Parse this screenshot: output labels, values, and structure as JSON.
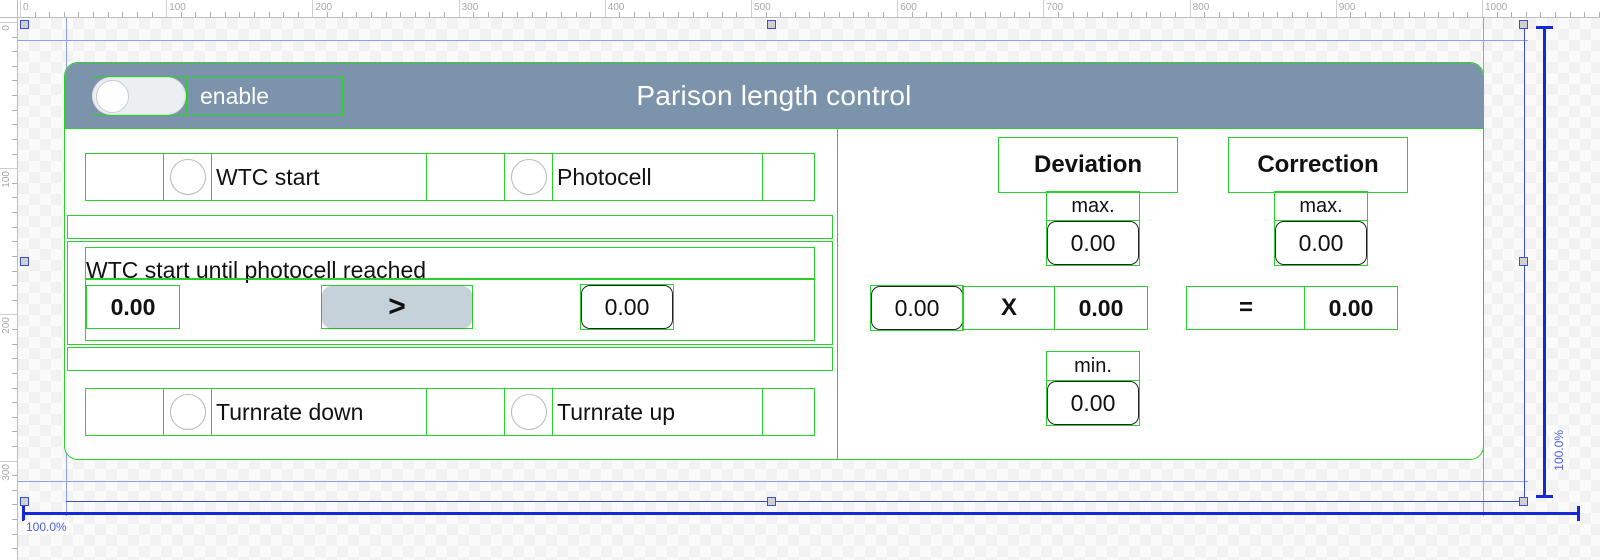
{
  "editor": {
    "ruler_h_labels": [
      "0",
      "100",
      "200",
      "300",
      "400",
      "500",
      "600",
      "700",
      "800",
      "900",
      "1000"
    ],
    "ruler_v_labels": [
      "0",
      "100",
      "200",
      "300"
    ],
    "zoom_bottom": "100.0%",
    "zoom_right": "100.0%"
  },
  "widget": {
    "header": {
      "title": "Parison length control",
      "toggle_name": "enable-toggle",
      "toggle_state": "off",
      "enable_label": "enable",
      "bg_color": "#7b93ab",
      "title_color": "#ffffff"
    },
    "left": {
      "top_row": [
        {
          "label": "WTC start",
          "led": "indicator-off"
        },
        {
          "label": "Photocell",
          "led": "indicator-off"
        }
      ],
      "middle": {
        "title": "WTC start until photocell reached",
        "actual_value": "0.00",
        "button_label": ">",
        "setpoint_value": "0.00"
      },
      "bottom_row": [
        {
          "label": "Turnrate down",
          "led": "indicator-off"
        },
        {
          "label": "Turnrate up",
          "led": "indicator-off"
        }
      ]
    },
    "right": {
      "columns": [
        {
          "title": "Deviation",
          "max_caption": "max.",
          "max_value": "0.00"
        },
        {
          "title": "Correction",
          "max_caption": "max.",
          "max_value": "0.00"
        }
      ],
      "equation": {
        "operand_a": "0.00",
        "operator_mul": "X",
        "operand_b": "0.00",
        "operator_eq": "=",
        "result": "0.00"
      },
      "min_caption": "min.",
      "min_value": "0.00"
    }
  },
  "colors": {
    "guide_green": "#2ad12a",
    "guide_blue": "#8ca0ee",
    "measure_blue": "#1728d8",
    "button_gray": "#c6d2da"
  }
}
